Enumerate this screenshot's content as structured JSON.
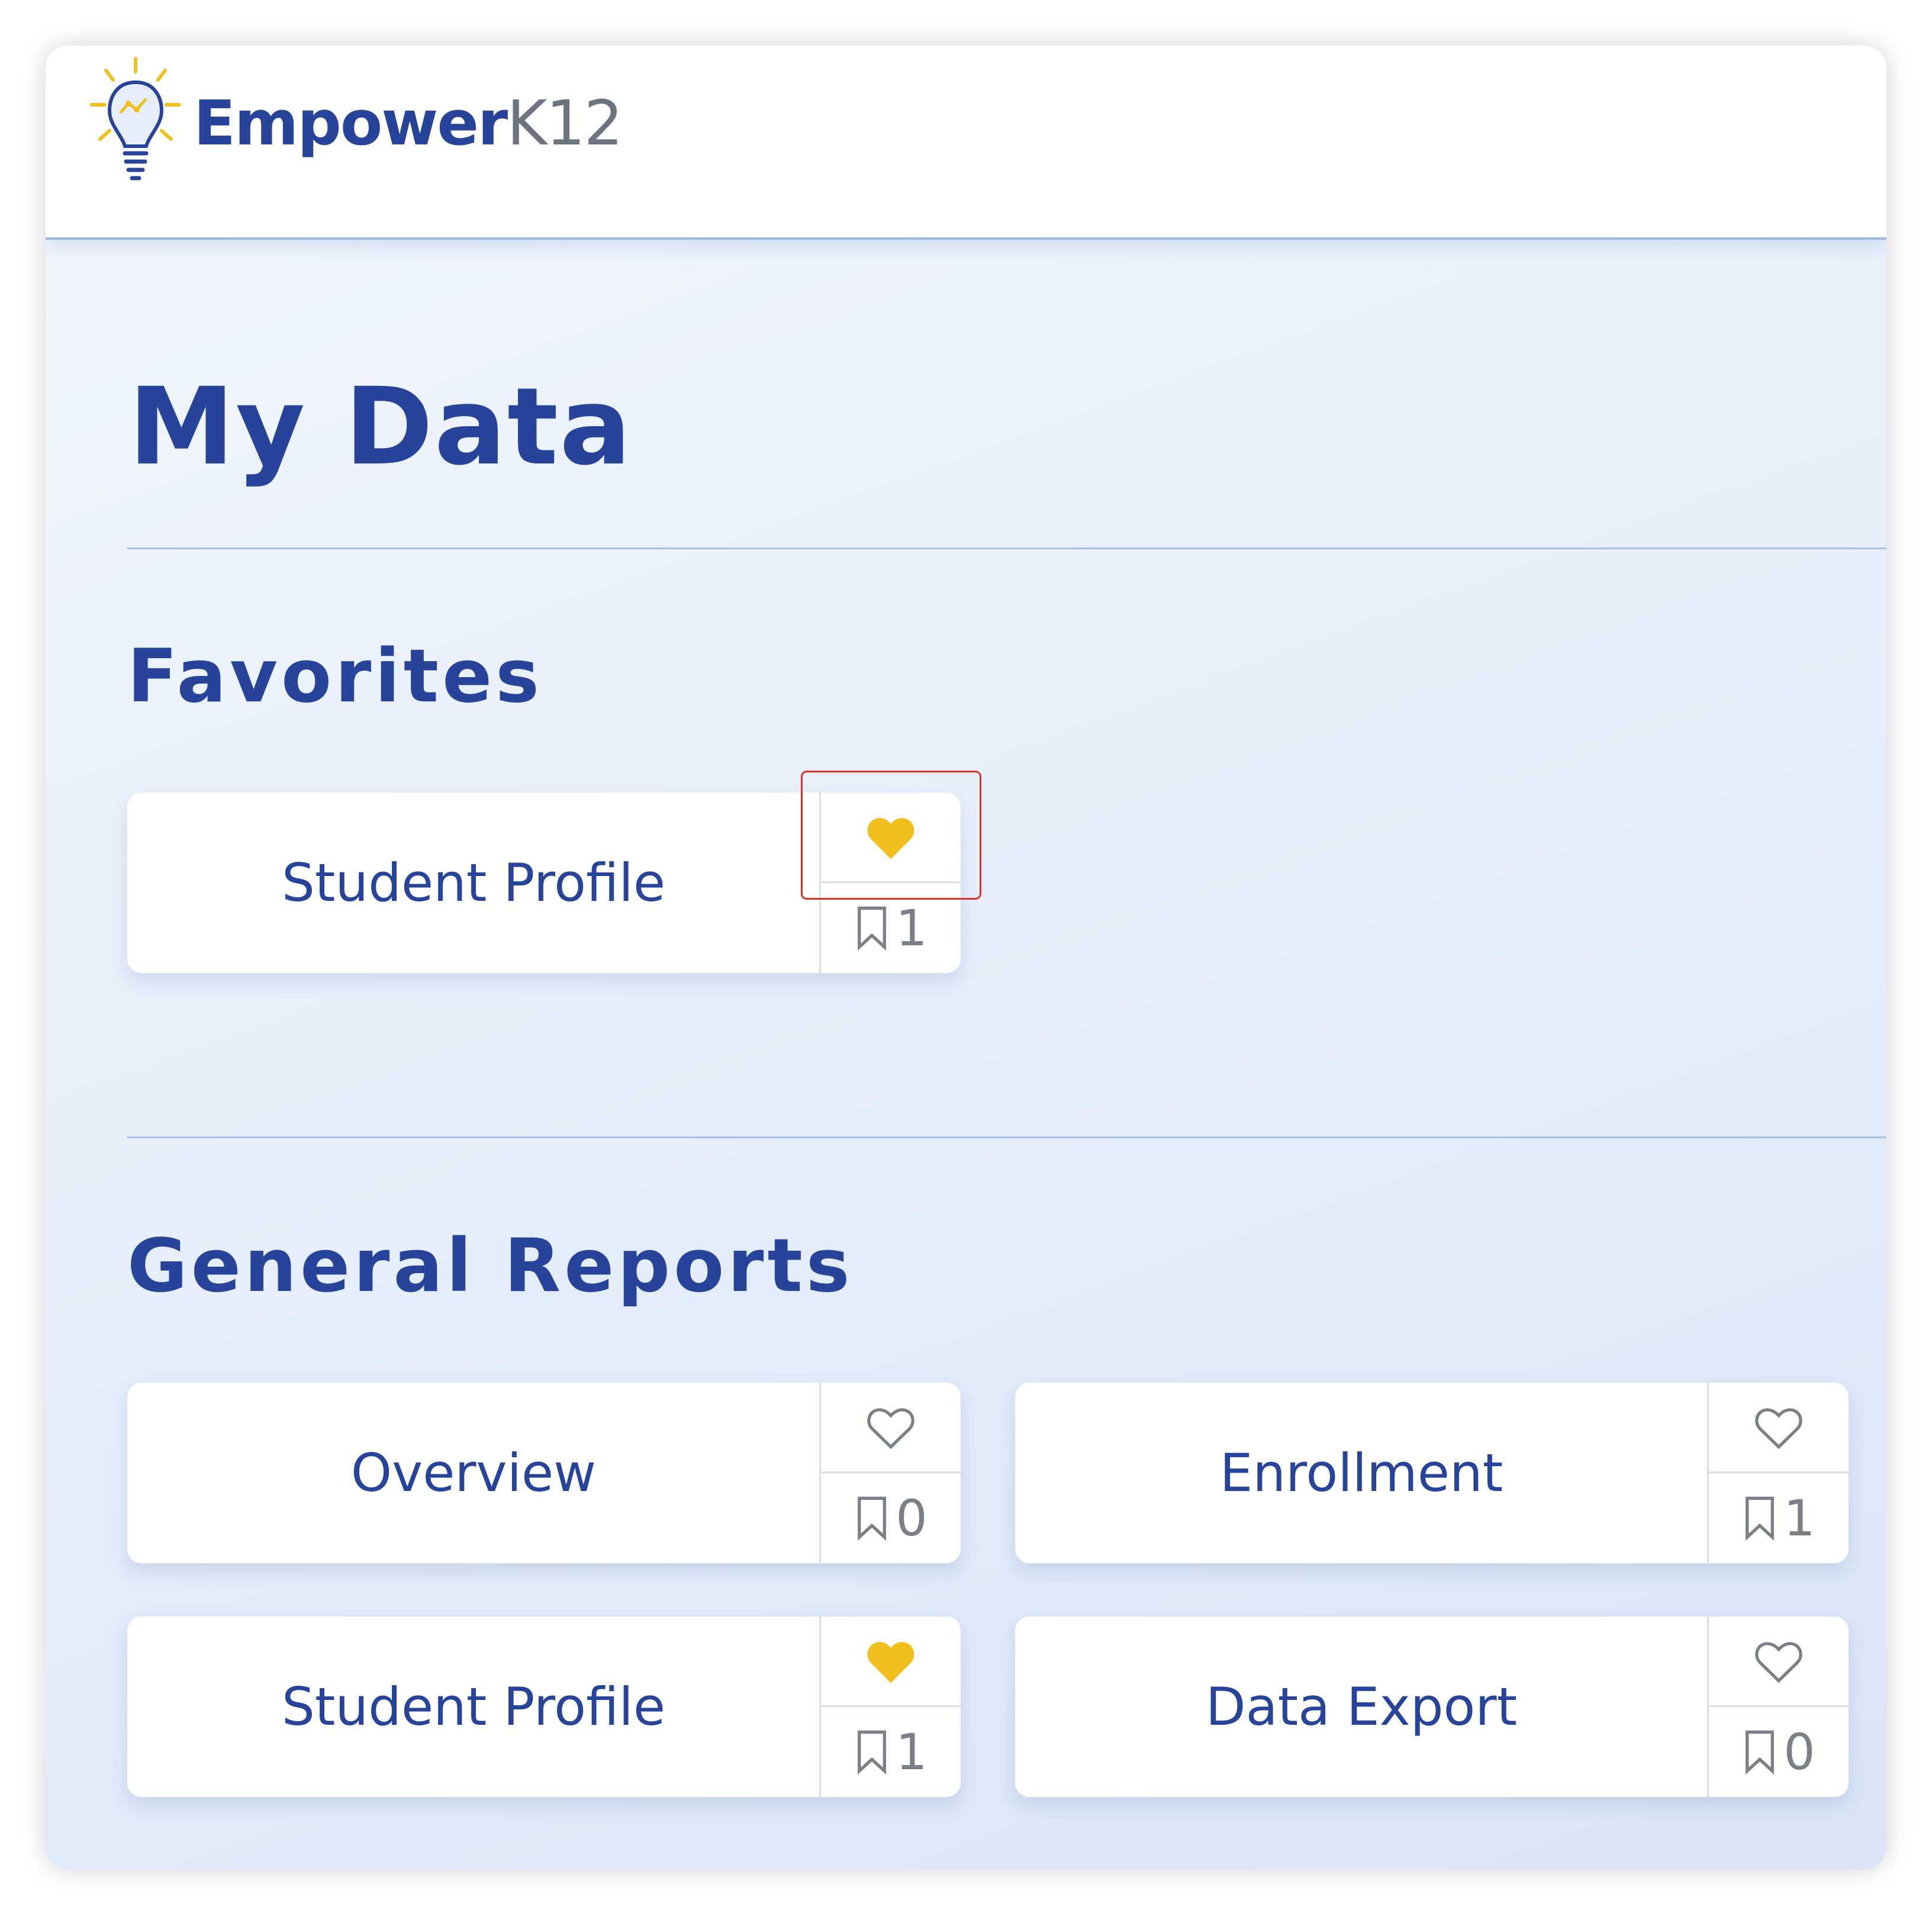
{
  "header": {
    "brand_primary": "Empower",
    "brand_secondary": "K12",
    "logo_icon": "lightbulb-icon"
  },
  "page": {
    "title": "My Data"
  },
  "favorites": {
    "title": "Favorites",
    "cards": [
      {
        "label": "Student Profile",
        "favorited": true,
        "bookmark_count": "1"
      }
    ]
  },
  "general_reports": {
    "title": "General Reports",
    "cards": [
      {
        "label": "Overview",
        "favorited": false,
        "bookmark_count": "0"
      },
      {
        "label": "Enrollment",
        "favorited": false,
        "bookmark_count": "1"
      },
      {
        "label": "Student Profile",
        "favorited": true,
        "bookmark_count": "1"
      },
      {
        "label": "Data Export",
        "favorited": false,
        "bookmark_count": "0"
      }
    ]
  },
  "colors": {
    "brand_blue": "#27449a",
    "favorite_gold": "#f2c01e",
    "highlight_red": "#d9322b"
  }
}
